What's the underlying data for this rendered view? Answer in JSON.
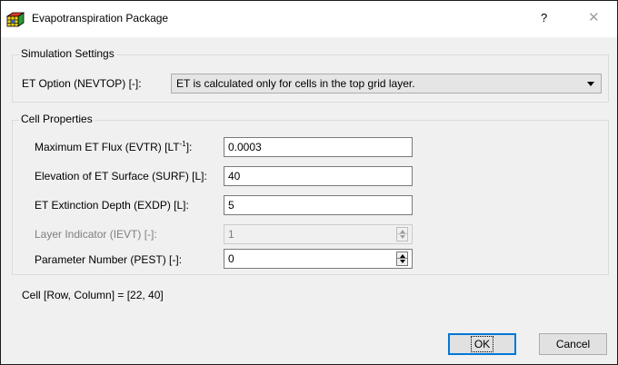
{
  "window": {
    "title": "Evapotranspiration Package",
    "help_label": "?",
    "close_label": "✕"
  },
  "simulation": {
    "group_title": "Simulation Settings",
    "et_option_label": "ET Option (NEVTOP) [-]:",
    "et_option_value": "ET is calculated only for cells in the top grid layer."
  },
  "cell_properties": {
    "group_title": "Cell Properties",
    "max_et_flux_label_pre": "Maximum ET Flux (EVTR) [LT",
    "max_et_flux_label_sup": "-1",
    "max_et_flux_label_post": "]:",
    "max_et_flux_value": "0.0003",
    "elevation_label": "Elevation of ET Surface (SURF) [L]:",
    "elevation_value": "40",
    "extinction_label": "ET Extinction Depth (EXDP) [L]:",
    "extinction_value": "5",
    "layer_indicator_label": "Layer Indicator (IEVT) [-]:",
    "layer_indicator_value": "1",
    "parameter_number_label": "Parameter Number (PEST) [-]:",
    "parameter_number_value": "0"
  },
  "status": {
    "cell_info": "Cell [Row, Column] = [22, 40]"
  },
  "buttons": {
    "ok_label": "OK",
    "cancel_label": "Cancel"
  },
  "icons": {
    "app_icon": "grid-cube-icon",
    "help": "question-mark-icon",
    "close": "close-icon",
    "dropdown": "chevron-down-icon",
    "spinner": "spin-arrows-icon"
  },
  "colors": {
    "dialog_bg": "#f0f0f0",
    "titlebar_bg": "#ffffff",
    "default_button_border": "#0078d7",
    "disabled_text": "#7f7f7f"
  }
}
